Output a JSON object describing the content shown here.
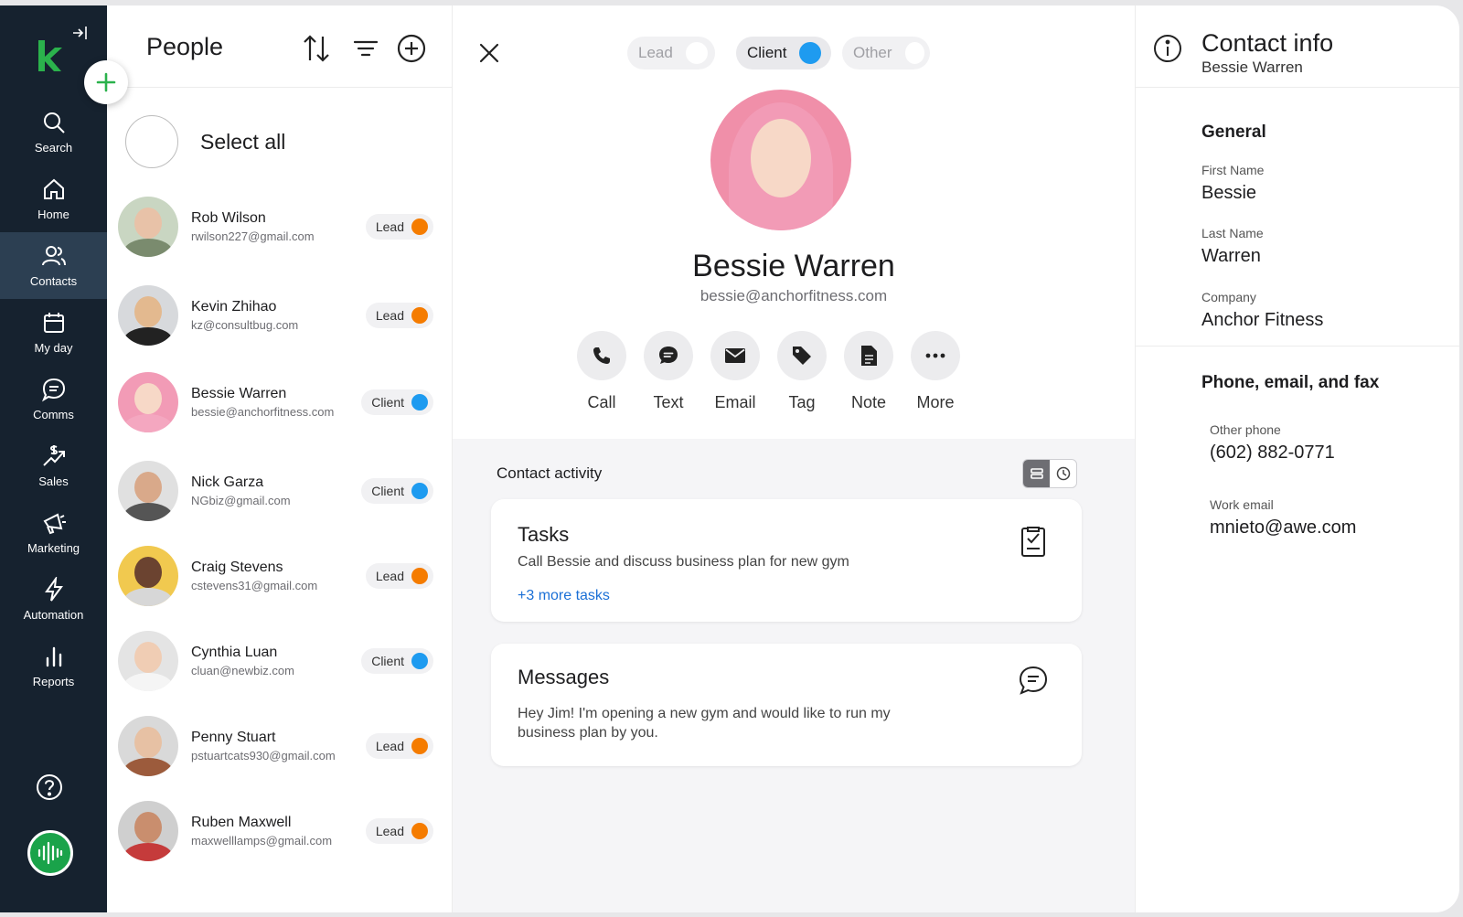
{
  "sidebar": {
    "nav": [
      {
        "label": "Search",
        "icon": "search-icon"
      },
      {
        "label": "Home",
        "icon": "home-icon"
      },
      {
        "label": "Contacts",
        "icon": "contacts-icon",
        "active": true
      },
      {
        "label": "My day",
        "icon": "calendar-icon"
      },
      {
        "label": "Comms",
        "icon": "chat-icon"
      },
      {
        "label": "Sales",
        "icon": "sales-icon"
      },
      {
        "label": "Marketing",
        "icon": "megaphone-icon"
      },
      {
        "label": "Automation",
        "icon": "lightning-icon"
      },
      {
        "label": "Reports",
        "icon": "bar-chart-icon"
      }
    ]
  },
  "people": {
    "title": "People",
    "select_all": "Select all",
    "list": [
      {
        "name": "Rob Wilson",
        "email": "rwilson227@gmail.com",
        "status": "Lead"
      },
      {
        "name": "Kevin Zhihao",
        "email": "kz@consultbug.com",
        "status": "Lead"
      },
      {
        "name": "Bessie Warren",
        "email": "bessie@anchorfitness.com",
        "status": "Client"
      },
      {
        "name": "Nick Garza",
        "email": "NGbiz@gmail.com",
        "status": "Client"
      },
      {
        "name": "Craig Stevens",
        "email": "cstevens31@gmail.com",
        "status": "Lead"
      },
      {
        "name": "Cynthia Luan",
        "email": "cluan@newbiz.com",
        "status": "Client"
      },
      {
        "name": "Penny Stuart",
        "email": "pstuartcats930@gmail.com",
        "status": "Lead"
      },
      {
        "name": "Ruben Maxwell",
        "email": "maxwelllamps@gmail.com",
        "status": "Lead"
      }
    ]
  },
  "detail": {
    "segments": [
      {
        "label": "Lead",
        "selected": false
      },
      {
        "label": "Client",
        "selected": true
      },
      {
        "label": "Other",
        "selected": false
      }
    ],
    "name": "Bessie Warren",
    "email": "bessie@anchorfitness.com",
    "actions": [
      {
        "label": "Call",
        "icon": "phone-icon"
      },
      {
        "label": "Text",
        "icon": "text-bubble-icon"
      },
      {
        "label": "Email",
        "icon": "envelope-icon"
      },
      {
        "label": "Tag",
        "icon": "tag-icon"
      },
      {
        "label": "Note",
        "icon": "note-icon"
      },
      {
        "label": "More",
        "icon": "more-icon"
      }
    ],
    "activity_title": "Contact activity",
    "tasks": {
      "title": "Tasks",
      "text": "Call Bessie and discuss business plan for new gym",
      "more": "+3 more tasks"
    },
    "messages": {
      "title": "Messages",
      "line1": "Hey Jim! I'm opening a new gym and would like to run my",
      "line2": "business plan by you."
    }
  },
  "info": {
    "title": "Contact info",
    "subtitle": "Bessie Warren",
    "general_title": "General",
    "first_name_label": "First Name",
    "first_name": "Bessie",
    "last_name_label": "Last Name",
    "last_name": "Warren",
    "company_label": "Company",
    "company": "Anchor Fitness",
    "phone_section_title": "Phone, email, and fax",
    "other_phone_label": "Other phone",
    "other_phone": "(602) 882-0771",
    "work_email_label": "Work email",
    "work_email": "mnieto@awe.com"
  },
  "colors": {
    "lead": "#f57c00",
    "client": "#1e9bf0",
    "sidebar": "#16222f",
    "brand_green": "#2bb24c",
    "link": "#1a6fd6"
  }
}
